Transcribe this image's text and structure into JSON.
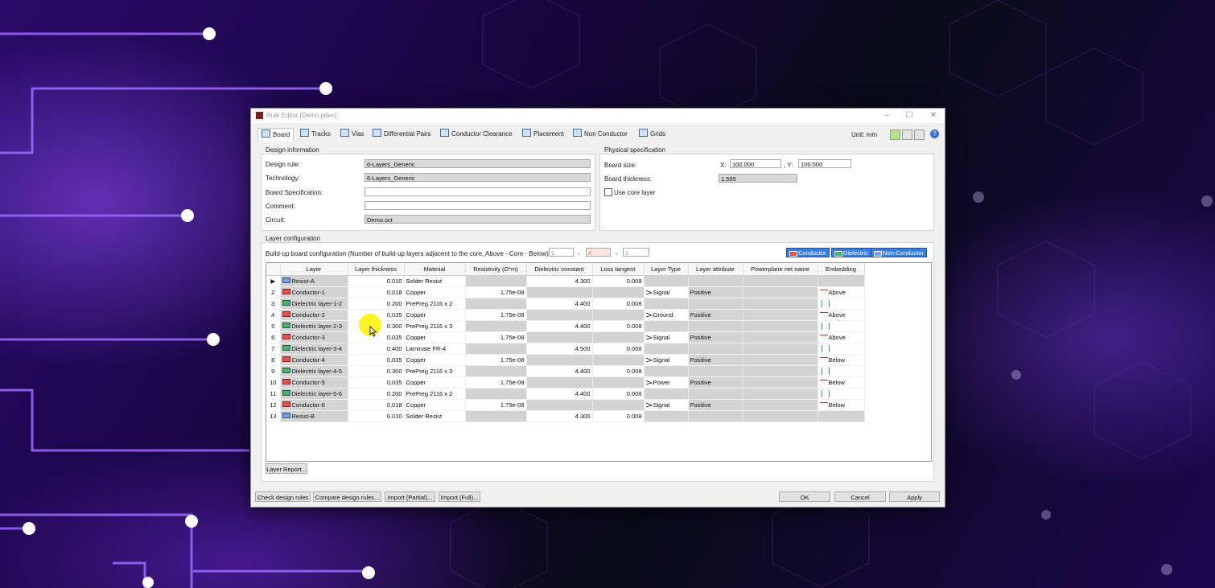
{
  "window": {
    "title": "Rule Editor [Demo.pdes]"
  },
  "tabs": [
    "Board",
    "Tracks",
    "Vias",
    "Differential Pairs",
    "Conductor Clearance",
    "Placement",
    "Non Conductor",
    "Grids"
  ],
  "unit": "Unit: mm",
  "design_info": {
    "heading": "Design information",
    "design_rule_label": "Design rule:",
    "design_rule": "6-Layers_Generic",
    "technology_label": "Technology:",
    "technology": "6-Layers_Generic",
    "board_spec_label": "Board Specification:",
    "board_spec": "",
    "comment_label": "Comment:",
    "comment": "",
    "circuit_label": "Circuit:",
    "circuit": "Demo.sct"
  },
  "physical": {
    "heading": "Physical specification",
    "board_size_label": "Board size:",
    "x_label": "X:",
    "x": "100.000",
    "y_label": ", Y:",
    "y": "100.000",
    "thickness_label": "Board thickness:",
    "thickness": "1.595",
    "use_core_label": "Use core layer"
  },
  "layer_config": {
    "heading": "Layer configuration",
    "buildup_label": "Build-up board configuration (Number of build-up layers adjacent to the core, Above - Core - Below):",
    "above": "1",
    "sep1": "-",
    "core": "4",
    "sep2": "-",
    "below": "1",
    "legend": [
      "Conductor",
      "Dielectric",
      "Non-Conductor"
    ]
  },
  "columns": [
    "",
    "Layer",
    "Layer thickness",
    "Material",
    "Resistivity (Ω*m)",
    "Dielectric constant",
    "Loss tangent",
    "Layer Type",
    "Layer attribute",
    "Powerplane net name",
    "Embedding"
  ],
  "rows": [
    {
      "idx": "▶",
      "kind": "non",
      "layer": "Resist-A",
      "thick": "0.010",
      "material": "Solder Resist",
      "res": "",
      "dc": "4.300",
      "lt": "0.008",
      "type": "",
      "attr": "",
      "net": "",
      "emb": ""
    },
    {
      "idx": "2",
      "kind": "cond",
      "layer": "Conductor-1",
      "thick": "0.018",
      "material": "Copper",
      "res": "1.75e-08",
      "dc": "",
      "lt": "",
      "type": "Signal",
      "attr": "Positive",
      "net": "",
      "emb": "Above"
    },
    {
      "idx": "3",
      "kind": "diel",
      "layer": "Dielectric layer-1-2",
      "thick": "0.200",
      "material": "PrePreg 2116 x 2",
      "res": "",
      "dc": "4.400",
      "lt": "0.008",
      "type": "",
      "attr": "",
      "net": "",
      "emb": ""
    },
    {
      "idx": "4",
      "kind": "cond",
      "layer": "Conductor-2",
      "thick": "0.035",
      "material": "Copper",
      "res": "1.75e-08",
      "dc": "",
      "lt": "",
      "type": "Ground",
      "attr": "Positive",
      "net": "",
      "emb": "Above"
    },
    {
      "idx": "5",
      "kind": "diel",
      "layer": "Dielectric layer-2-3",
      "thick": "0.300",
      "material": "PrePreg 2116 x 3",
      "res": "",
      "dc": "4.400",
      "lt": "0.008",
      "type": "",
      "attr": "",
      "net": "",
      "emb": ""
    },
    {
      "idx": "6",
      "kind": "cond",
      "layer": "Conductor-3",
      "thick": "0.035",
      "material": "Copper",
      "res": "1.75e-08",
      "dc": "",
      "lt": "",
      "type": "Signal",
      "attr": "Positive",
      "net": "",
      "emb": "Above"
    },
    {
      "idx": "7",
      "kind": "diel",
      "layer": "Dielectric layer-3-4",
      "thick": "0.400",
      "material": "Laminate FR-4",
      "res": "",
      "dc": "4.500",
      "lt": "0.008",
      "type": "",
      "attr": "",
      "net": "",
      "emb": ""
    },
    {
      "idx": "8",
      "kind": "cond",
      "layer": "Conductor-4",
      "thick": "0.035",
      "material": "Copper",
      "res": "1.75e-08",
      "dc": "",
      "lt": "",
      "type": "Signal",
      "attr": "Positive",
      "net": "",
      "emb": "Below"
    },
    {
      "idx": "9",
      "kind": "diel",
      "layer": "Dielectric layer-4-5",
      "thick": "0.300",
      "material": "PrePreg 2116 x 3",
      "res": "",
      "dc": "4.400",
      "lt": "0.008",
      "type": "",
      "attr": "",
      "net": "",
      "emb": ""
    },
    {
      "idx": "10",
      "kind": "cond",
      "layer": "Conductor-5",
      "thick": "0.035",
      "material": "Copper",
      "res": "1.75e-08",
      "dc": "",
      "lt": "",
      "type": "Power",
      "attr": "Positive",
      "net": "",
      "emb": "Below"
    },
    {
      "idx": "11",
      "kind": "diel",
      "layer": "Dielectric layer-5-6",
      "thick": "0.200",
      "material": "PrePreg 2116 x 2",
      "res": "",
      "dc": "4.400",
      "lt": "0.008",
      "type": "",
      "attr": "",
      "net": "",
      "emb": ""
    },
    {
      "idx": "12",
      "kind": "cond",
      "layer": "Conductor-6",
      "thick": "0.018",
      "material": "Copper",
      "res": "1.75e-08",
      "dc": "",
      "lt": "",
      "type": "Signal",
      "attr": "Positive",
      "net": "",
      "emb": "Below"
    },
    {
      "idx": "13",
      "kind": "non",
      "layer": "Resist-B",
      "thick": "0.010",
      "material": "Solder Resist",
      "res": "",
      "dc": "4.300",
      "lt": "0.008",
      "type": "",
      "attr": "",
      "net": "",
      "emb": ""
    }
  ],
  "layer_report": "Layer Report...",
  "bottom": {
    "check": "Check design rules",
    "compare": "Compare design rules...",
    "import_partial": "Import (Partial)...",
    "import_full": "Import (Full)...",
    "ok": "OK",
    "cancel": "Cancel",
    "apply": "Apply"
  }
}
